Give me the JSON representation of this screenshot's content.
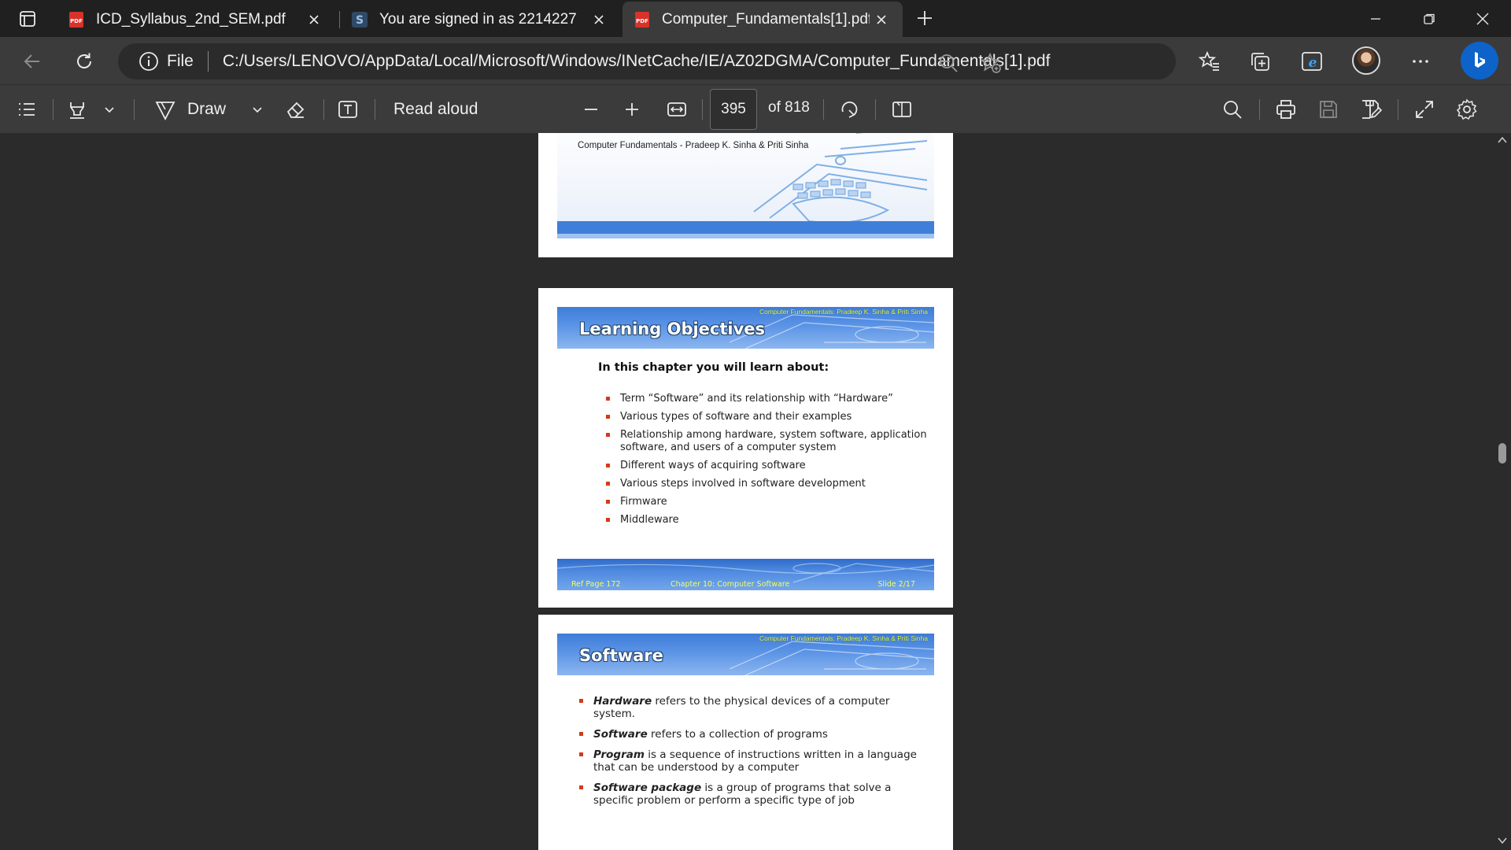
{
  "browser": {
    "tabs": [
      {
        "title": "ICD_Syllabus_2nd_SEM.pdf",
        "icon": "pdf-icon",
        "active": false
      },
      {
        "title": "You are signed in as 2214227",
        "icon": "s-site-icon",
        "active": false
      },
      {
        "title": "Computer_Fundamentals[1].pdf",
        "icon": "pdf-icon",
        "active": true
      }
    ],
    "address": {
      "scheme": "File",
      "url": "C:/Users/LENOVO/AppData/Local/Microsoft/Windows/INetCache/IE/AZ02DGMA/Computer_Fundamentals[1].pdf"
    }
  },
  "pdf_toolbar": {
    "draw_label": "Draw",
    "read_aloud_label": "Read aloud",
    "page_current": "395",
    "page_total": "of 818"
  },
  "document": {
    "cover_credit": "Computer Fundamentals - Pradeep K. Sinha & Priti Sinha",
    "header_credit": "Computer Fundamentals: Pradeep K. Sinha & Priti Sinha",
    "slide1": {
      "title": "Learning Objectives",
      "intro": "In this chapter you will learn about:",
      "items": [
        "Term “Software” and its relationship with “Hardware”",
        "Various types of software and their examples",
        "Relationship among hardware, system software, application software, and users of a computer system",
        "Different ways of acquiring software",
        "Various steps involved in software development",
        "Firmware",
        "Middleware"
      ],
      "footer": {
        "ref": "Ref Page  172",
        "chapter": "Chapter 10: Computer Software",
        "slide": "Slide 2/17"
      }
    },
    "slide2": {
      "title": "Software",
      "items": [
        {
          "term": "Hardware",
          "text": " refers to the physical devices of a computer system."
        },
        {
          "term": "Software",
          "text": " refers to a collection of programs"
        },
        {
          "term": "Program",
          "text": " is a sequence of instructions written in a language that can be understood by a computer"
        },
        {
          "term": "Software package",
          "text": " is a group of programs that solve a specific problem or perform a specific type of job"
        }
      ]
    }
  }
}
